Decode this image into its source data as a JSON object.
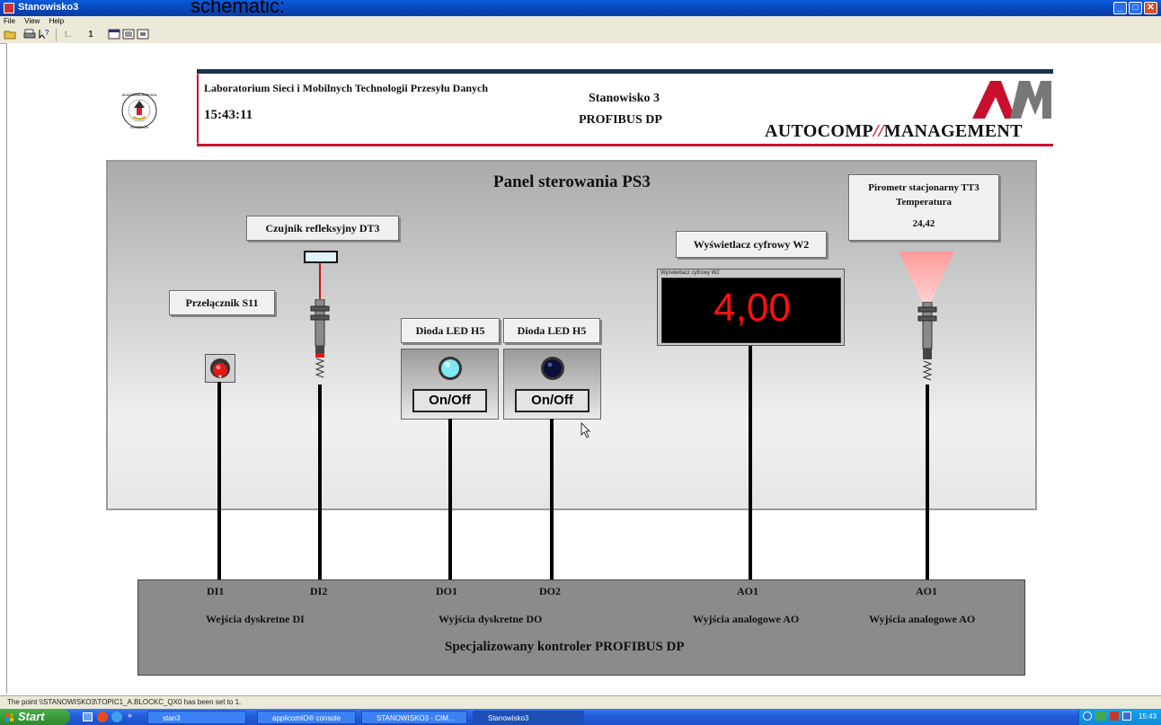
{
  "window": {
    "title": "Stanowisko3",
    "menu": [
      "File",
      "View",
      "Help"
    ],
    "toolbar": {
      "page_number": "1"
    },
    "overlay_text": "schematic:"
  },
  "header": {
    "lab_name": "Laboratorium Sieci i Mobilnych Technologii Przesyłu Danych",
    "time": "15:43:11",
    "station": "Stanowisko 3",
    "protocol": "PROFIBUS DP",
    "company": "AUTOCOMP",
    "company2": "MANAGEMENT",
    "logo_letters": "AM"
  },
  "panel": {
    "title": "Panel sterowania PS3",
    "switch_label": "Przełącznik S11",
    "sensor_label": "Czujnik refleksyjny DT3",
    "led1_label": "Dioda LED H5",
    "led2_label": "Dioda LED H5",
    "led_button": "On/Off",
    "display_label": "Wyświetlacz cyfrowy W2",
    "display_caption": "Wyświetlacz cyfrowy W2",
    "display_value": "4,00",
    "pyrometer_title": "Pirometr stacjonarny TT3",
    "pyrometer_subtitle": "Temperatura",
    "pyrometer_value": "24,42",
    "colors": {
      "led_on": "#7fe8f0",
      "led_off": "#0a0f3a",
      "display_digits": "#ff1010",
      "switch": "#e01818"
    }
  },
  "controller": {
    "ports": [
      "DI1",
      "DI2",
      "DO1",
      "DO2",
      "AO1",
      "AO1"
    ],
    "group_di": "Wejścia dyskretne DI",
    "group_do": "Wyjścia dyskretne DO",
    "group_ao1": "Wyjścia analogowe AO",
    "group_ao2": "Wyjścia analogowe AO",
    "name": "Specjalizowany kontroler PROFIBUS DP"
  },
  "status": {
    "message": "The point \\\\STANOWISKO3\\TOPIC1_A.BLOCKC_QX0 has been set to 1."
  },
  "taskbar": {
    "start": "Start",
    "tasks": [
      "stan3",
      "applicomIO® console",
      "STANOWISKO3 - CIM...",
      "Stanowisko3"
    ],
    "clock": "15:43"
  }
}
